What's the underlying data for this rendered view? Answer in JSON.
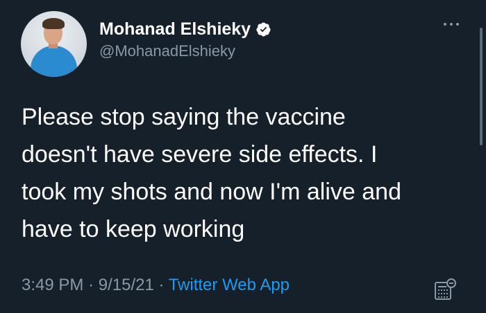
{
  "tweet": {
    "display_name": "Mohanad Elshieky",
    "handle": "@MohanadElshieky",
    "text": "Please stop saying the vaccine\ndoesn't have severe side effects. I\ntook my shots and now I'm alive and\nhave to keep working",
    "time": "3:49 PM",
    "date": "9/15/21",
    "separator": "·",
    "source_app": "Twitter Web App"
  },
  "icons": {
    "verified": "verified-badge-icon",
    "more": "more-options-icon",
    "analytics": "tweet-analytics-icon"
  },
  "colors": {
    "background": "#15202b",
    "text_primary": "#ffffff",
    "text_secondary": "#8b98a5",
    "accent": "#1d9bf0"
  }
}
